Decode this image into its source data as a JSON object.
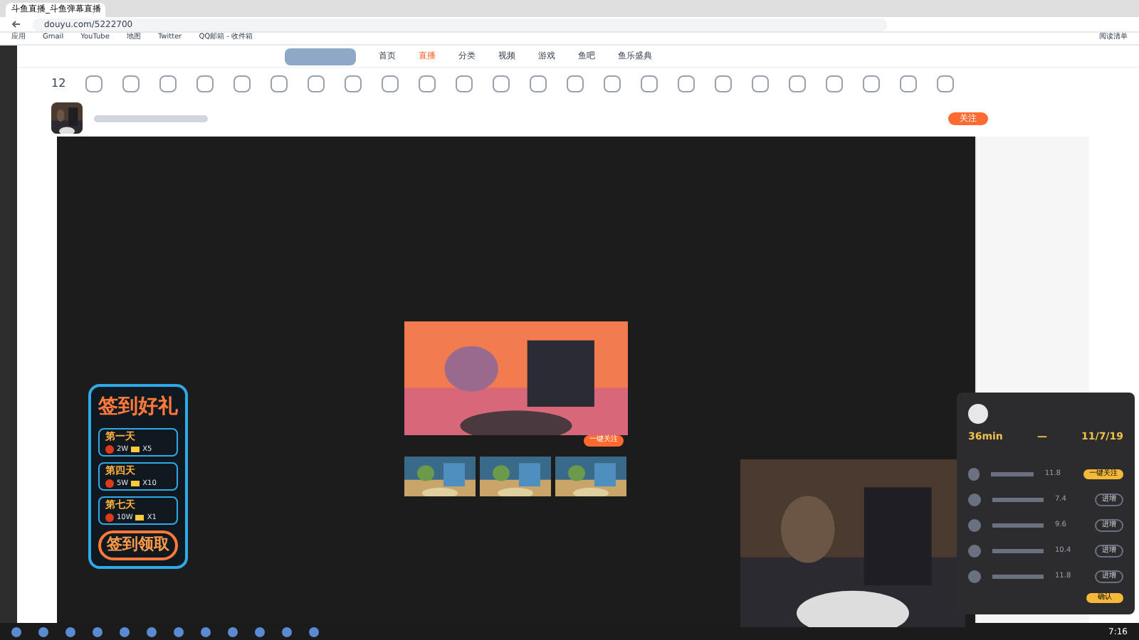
{
  "browser": {
    "tab_title": "斗鱼直播_斗鱼弹幕直播",
    "url": "douyu.com/5222700",
    "bookmarks": [
      "应用",
      "Gmail",
      "YouTube",
      "地图",
      "Twitter",
      "QQ邮箱 - 收件箱"
    ],
    "reading_list": "阅读清单"
  },
  "site_nav": [
    {
      "label": "首页",
      "selected": false
    },
    {
      "label": "直播",
      "selected": true
    },
    {
      "label": "分类",
      "selected": false
    },
    {
      "label": "视频",
      "selected": false
    },
    {
      "label": "游戏",
      "selected": false
    },
    {
      "label": "鱼吧",
      "selected": false
    },
    {
      "label": "鱼乐盛典",
      "selected": false
    }
  ],
  "category_count": "12",
  "streamer": {
    "follow": "关注"
  },
  "sign_in": {
    "title": "签到好礼",
    "days": [
      {
        "day": "第一天",
        "coins": "2W",
        "count": "X5"
      },
      {
        "day": "第四天",
        "coins": "5W",
        "count": "X10"
      },
      {
        "day": "第七天",
        "coins": "10W",
        "count": "X1"
      }
    ],
    "button": "签到领取"
  },
  "video_panel": {
    "action": "一键关注"
  },
  "popup": {
    "stats": [
      "36min",
      "—",
      "11/7/19"
    ],
    "rows": [
      {
        "score": "11.8",
        "action": "一键关注",
        "kind": "primary"
      },
      {
        "score": "7.4",
        "action": "进增",
        "kind": "secondary"
      },
      {
        "score": "9.6",
        "action": "进增",
        "kind": "secondary"
      },
      {
        "score": "10.4",
        "action": "进增",
        "kind": "secondary"
      },
      {
        "score": "11.8",
        "action": "进增",
        "kind": "secondary"
      }
    ],
    "confirm": "确认"
  },
  "taskbar": {
    "time": "7:16"
  }
}
